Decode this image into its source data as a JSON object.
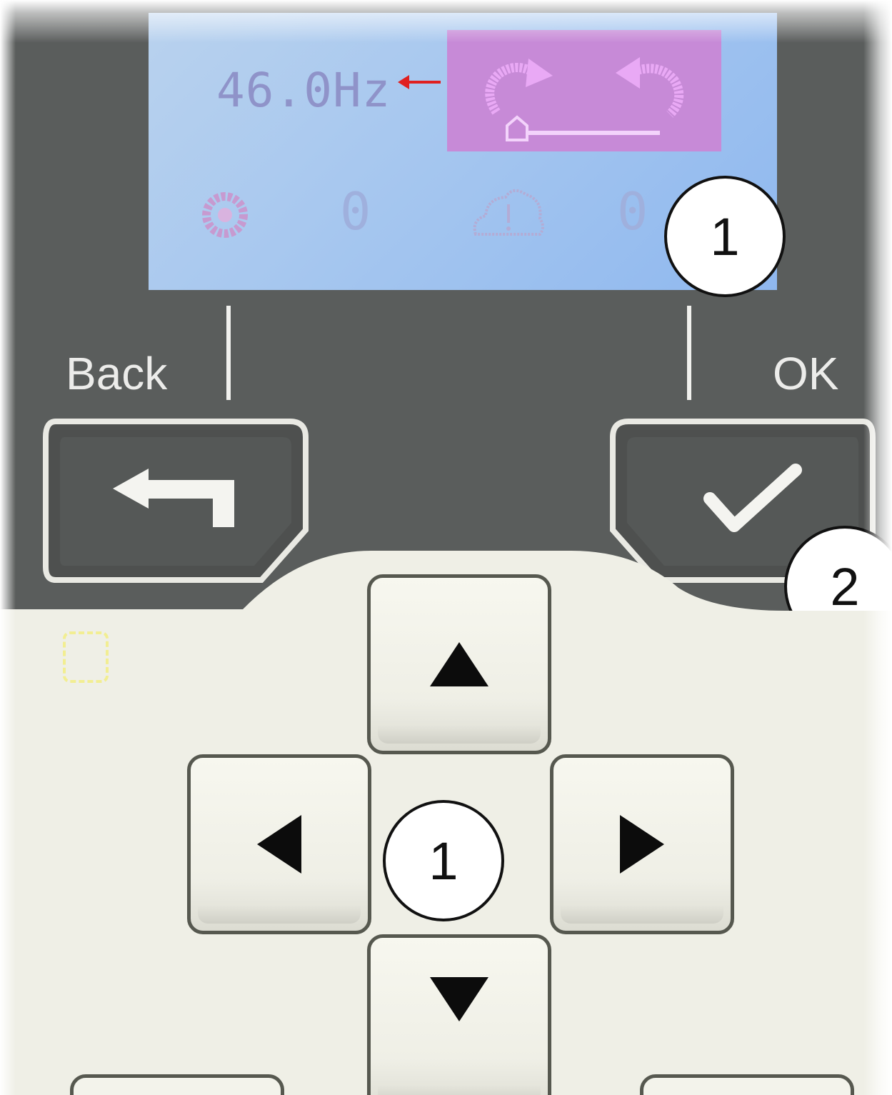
{
  "display": {
    "frequency": "46.0Hz",
    "status_values": [
      "0",
      "0"
    ]
  },
  "keys": {
    "back_label": "Back",
    "ok_label": "OK"
  },
  "callouts": {
    "display_marker": "1",
    "ok_marker": "2",
    "nav_marker": "1"
  },
  "colors": {
    "panel": "#5a5d5c",
    "lcd": "#a8c8ef",
    "lcd_text": "#8f93c9",
    "direction_box": "#c78ad7",
    "pointer_arrow": "#e02020",
    "keypad": "#efefe6"
  },
  "icons": [
    "arrow-left-icon",
    "rotate-forward-icon",
    "rotate-reverse-icon",
    "remote-control-icon",
    "gear-icon",
    "warning-icon",
    "back-return-icon",
    "checkmark-icon",
    "arrow-up-icon",
    "arrow-left-icon",
    "arrow-right-icon",
    "arrow-down-icon"
  ]
}
